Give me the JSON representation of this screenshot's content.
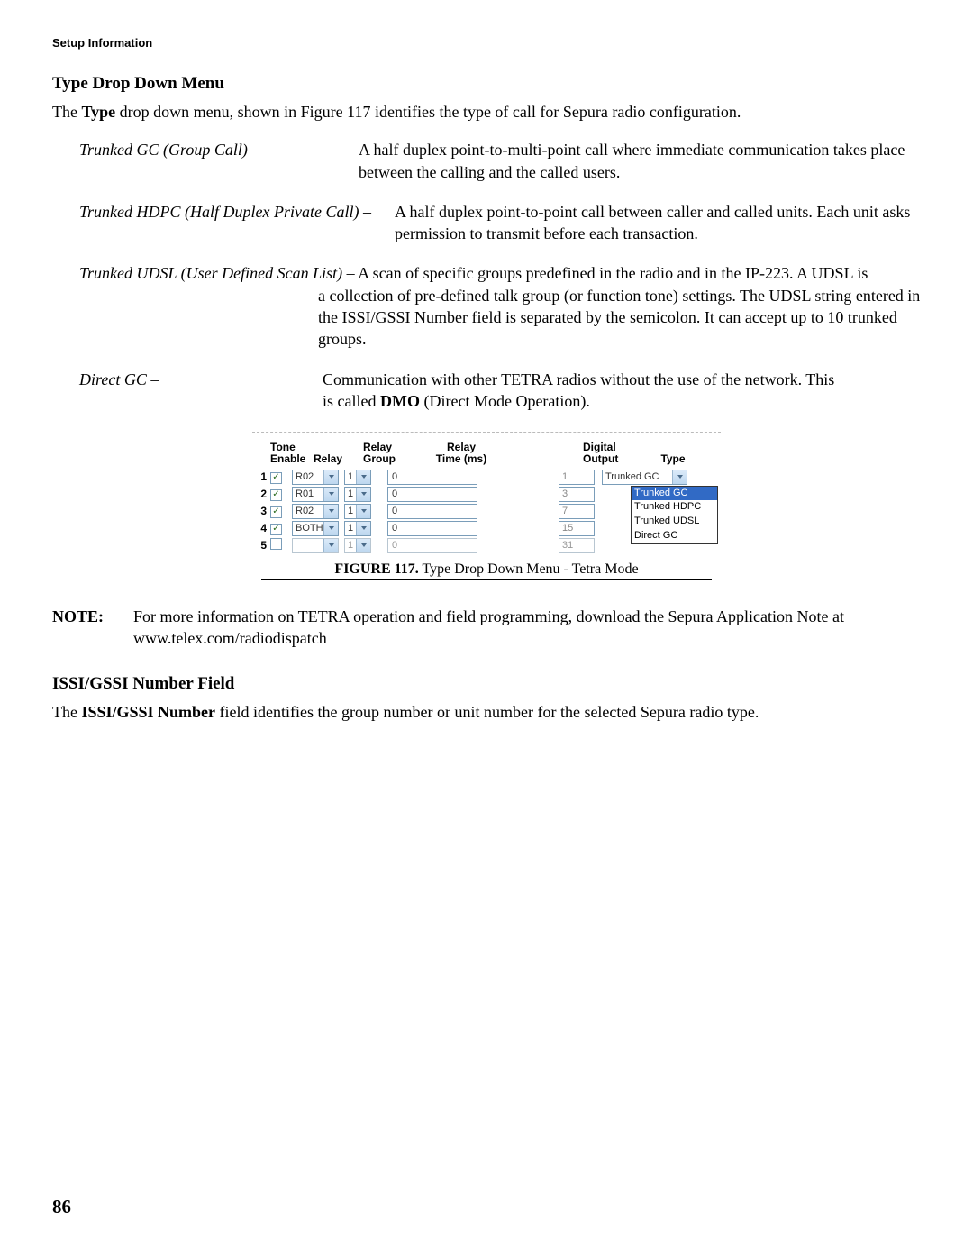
{
  "running_head": "Setup Information",
  "section1": {
    "title": "Type Drop Down Menu",
    "intro_pre": "The ",
    "intro_bold": "Type",
    "intro_post": " drop down menu, shown in Figure 117 identifies the type of call for Sepura radio configuration."
  },
  "defs": {
    "d1_term": "Trunked GC (Group Call) –",
    "d1_desc": "A half duplex point-to-multi-point call where immediate communication takes place between the calling and the called users.",
    "d2_term": "Trunked HDPC (Half Duplex Private Call) –",
    "d2_desc": "A half duplex point-to-point call between caller and called units. Each unit asks permission to transmit before each transaction.",
    "d3_term": "Trunked UDSL (User Defined Scan List) –",
    "d3_lead": " A scan of specific groups predefined in the radio and in the IP-223. A UDSL is",
    "d3_cont": "a collection of pre-defined talk group (or function tone) settings. The UDSL string entered in the ISSI/GSSI Number field is separated by the semicolon. It can accept up to 10 trunked groups.",
    "d4_term": "Direct GC –",
    "d4_lead": "Communication with other TETRA radios without the use of the network. This",
    "d4_cont_pre": "is called ",
    "d4_cont_bold": "DMO",
    "d4_cont_post": " (Direct Mode Operation)."
  },
  "figure": {
    "headers": {
      "tone": "Tone",
      "enable": "Enable",
      "relay": "Relay",
      "group": "Group",
      "relay_time_l1": "Relay",
      "relay_time_l2": "Time (ms)",
      "digital": "Digital",
      "output": "Output",
      "type": "Type"
    },
    "rows": [
      {
        "n": "1",
        "enabled": true,
        "relay": "R02",
        "group": "1",
        "time": "0",
        "output": "1",
        "type": "Trunked GC"
      },
      {
        "n": "2",
        "enabled": true,
        "relay": "R01",
        "group": "1",
        "time": "0",
        "output": "3",
        "type": ""
      },
      {
        "n": "3",
        "enabled": true,
        "relay": "R02",
        "group": "1",
        "time": "0",
        "output": "7",
        "type": ""
      },
      {
        "n": "4",
        "enabled": true,
        "relay": "BOTH",
        "group": "1",
        "time": "0",
        "output": "15",
        "type": ""
      },
      {
        "n": "5",
        "enabled": false,
        "relay": "",
        "group": "1",
        "time": "0",
        "output": "31",
        "type": ""
      }
    ],
    "type_options": [
      "Trunked GC",
      "Trunked HDPC",
      "Trunked UDSL",
      "Direct GC"
    ],
    "type_selected": "Trunked GC"
  },
  "caption_bold": "FIGURE 117.",
  "caption_rest": " Type Drop Down Menu - Tetra Mode",
  "note": {
    "label": "NOTE:",
    "text": "For more information on TETRA operation and field programming, download the Sepura Application Note at www.telex.com/radiodispatch"
  },
  "section2": {
    "title": "ISSI/GSSI Number Field",
    "intro_pre": "The ",
    "intro_bold": "ISSI/GSSI Number",
    "intro_post": " field identifies the group number or unit number for the selected Sepura radio type."
  },
  "page_number": "86"
}
